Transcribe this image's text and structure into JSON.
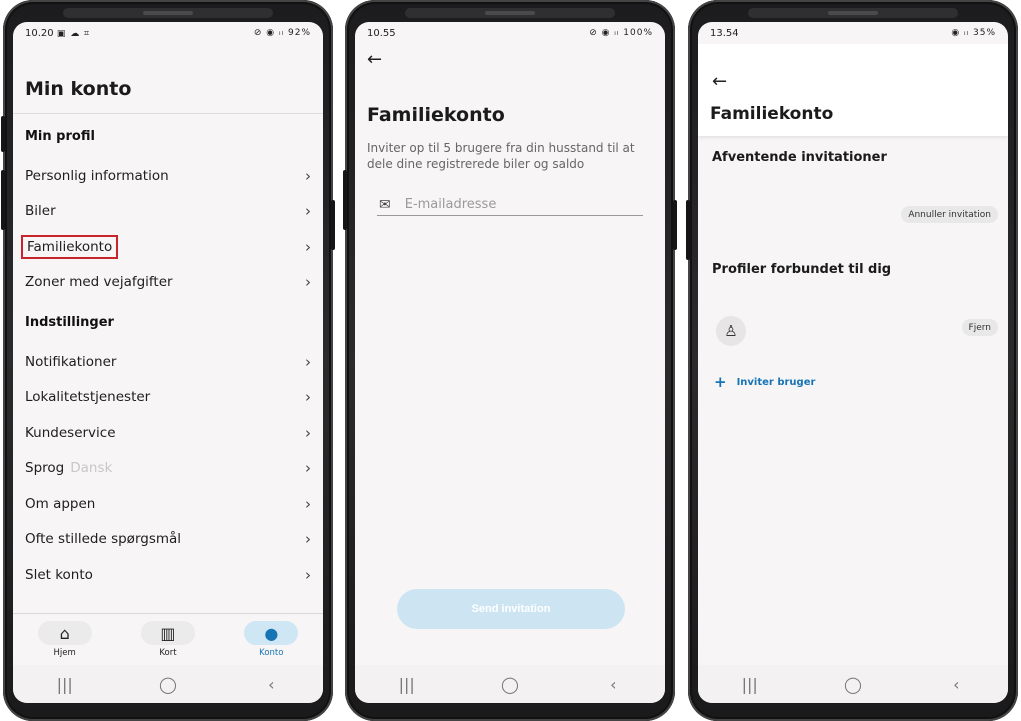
{
  "screen1": {
    "status_time": "10.20",
    "status_icons": "▣ ☁ ⌗",
    "status_right": "⊘ ◉ ᵢₗ 92%",
    "title": "Min konto",
    "sections": [
      {
        "heading": "Min profil",
        "items": [
          {
            "label": "Personlig information"
          },
          {
            "label": "Biler"
          },
          {
            "label": "Familiekonto"
          },
          {
            "label": "Zoner med vejafgifter"
          }
        ]
      },
      {
        "heading": "Indstillinger",
        "items": [
          {
            "label": "Notifikationer"
          },
          {
            "label": "Lokalitetstjenester"
          },
          {
            "label": "Kundeservice"
          },
          {
            "label": "Sprog",
            "sub": "Dansk"
          },
          {
            "label": "Om appen"
          },
          {
            "label": "Ofte stillede spørgsmål"
          },
          {
            "label": "Slet konto"
          }
        ]
      }
    ],
    "tabs": [
      {
        "label": "Hjem",
        "icon": "home-icon"
      },
      {
        "label": "Kort",
        "icon": "map-icon"
      },
      {
        "label": "Konto",
        "icon": "person-icon"
      }
    ],
    "highlight_color": "#c8242c",
    "accent_color": "#1774b5"
  },
  "screen2": {
    "status_time": "10.55",
    "status_right": "⊘ ◉ ᵢₗ 100%",
    "title": "Familiekonto",
    "description": "Inviter op til 5 brugere fra din husstand til at dele dine registrerede biler og saldo",
    "email_placeholder": "E-mailadresse",
    "send_button": "Send invitation"
  },
  "screen3": {
    "status_time": "13.54",
    "status_right": "◉ ᵢₗ 35%",
    "title": "Familiekonto",
    "pending_heading": "Afventende invitationer",
    "cancel_invite": "Annuller invitation",
    "connected_heading": "Profiler forbundet til dig",
    "remove": "Fjern",
    "invite_user": "Inviter bruger"
  },
  "navbar": {
    "recent": "|||",
    "home": "◯",
    "back": "‹"
  }
}
